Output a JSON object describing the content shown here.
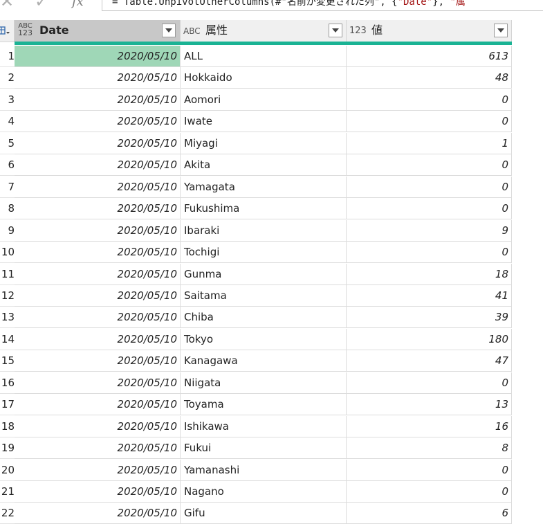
{
  "formula_bar": {
    "close_glyph": "✕",
    "check_glyph": "✓",
    "fx_label": "fx",
    "formula_prefix": "= Table.UnpivotOtherColumns(#\"名前が変更された列\", {",
    "formula_str1": "\"Date\"",
    "formula_mid": "}, ",
    "formula_str2": "\"属"
  },
  "table": {
    "row_selector_icon": "table-menu-icon",
    "columns": [
      {
        "type_glyph_top": "ABC",
        "type_glyph_bottom": "123",
        "type_icon": "any-type-icon",
        "label": "Date"
      },
      {
        "type_glyph": "ABC",
        "type_icon": "text-type-icon",
        "label": "属性"
      },
      {
        "type_glyph": "123",
        "type_icon": "number-type-icon",
        "label": "値"
      }
    ],
    "rows": [
      {
        "num": "1",
        "date": "2020/05/10",
        "attr": "ALL",
        "value": "613"
      },
      {
        "num": "2",
        "date": "2020/05/10",
        "attr": "Hokkaido",
        "value": "48"
      },
      {
        "num": "3",
        "date": "2020/05/10",
        "attr": "Aomori",
        "value": "0"
      },
      {
        "num": "4",
        "date": "2020/05/10",
        "attr": "Iwate",
        "value": "0"
      },
      {
        "num": "5",
        "date": "2020/05/10",
        "attr": "Miyagi",
        "value": "1"
      },
      {
        "num": "6",
        "date": "2020/05/10",
        "attr": "Akita",
        "value": "0"
      },
      {
        "num": "7",
        "date": "2020/05/10",
        "attr": "Yamagata",
        "value": "0"
      },
      {
        "num": "8",
        "date": "2020/05/10",
        "attr": "Fukushima",
        "value": "0"
      },
      {
        "num": "9",
        "date": "2020/05/10",
        "attr": "Ibaraki",
        "value": "9"
      },
      {
        "num": "10",
        "date": "2020/05/10",
        "attr": "Tochigi",
        "value": "0"
      },
      {
        "num": "11",
        "date": "2020/05/10",
        "attr": "Gunma",
        "value": "18"
      },
      {
        "num": "12",
        "date": "2020/05/10",
        "attr": "Saitama",
        "value": "41"
      },
      {
        "num": "13",
        "date": "2020/05/10",
        "attr": "Chiba",
        "value": "39"
      },
      {
        "num": "14",
        "date": "2020/05/10",
        "attr": "Tokyo",
        "value": "180"
      },
      {
        "num": "15",
        "date": "2020/05/10",
        "attr": "Kanagawa",
        "value": "47"
      },
      {
        "num": "16",
        "date": "2020/05/10",
        "attr": "Niigata",
        "value": "0"
      },
      {
        "num": "17",
        "date": "2020/05/10",
        "attr": "Toyama",
        "value": "13"
      },
      {
        "num": "18",
        "date": "2020/05/10",
        "attr": "Ishikawa",
        "value": "16"
      },
      {
        "num": "19",
        "date": "2020/05/10",
        "attr": "Fukui",
        "value": "8"
      },
      {
        "num": "20",
        "date": "2020/05/10",
        "attr": "Yamanashi",
        "value": "0"
      },
      {
        "num": "21",
        "date": "2020/05/10",
        "attr": "Nagano",
        "value": "0"
      },
      {
        "num": "22",
        "date": "2020/05/10",
        "attr": "Gifu",
        "value": "6"
      }
    ]
  },
  "colors": {
    "header_accent": "#1ab394",
    "selected_cell": "#9fd7b7"
  }
}
